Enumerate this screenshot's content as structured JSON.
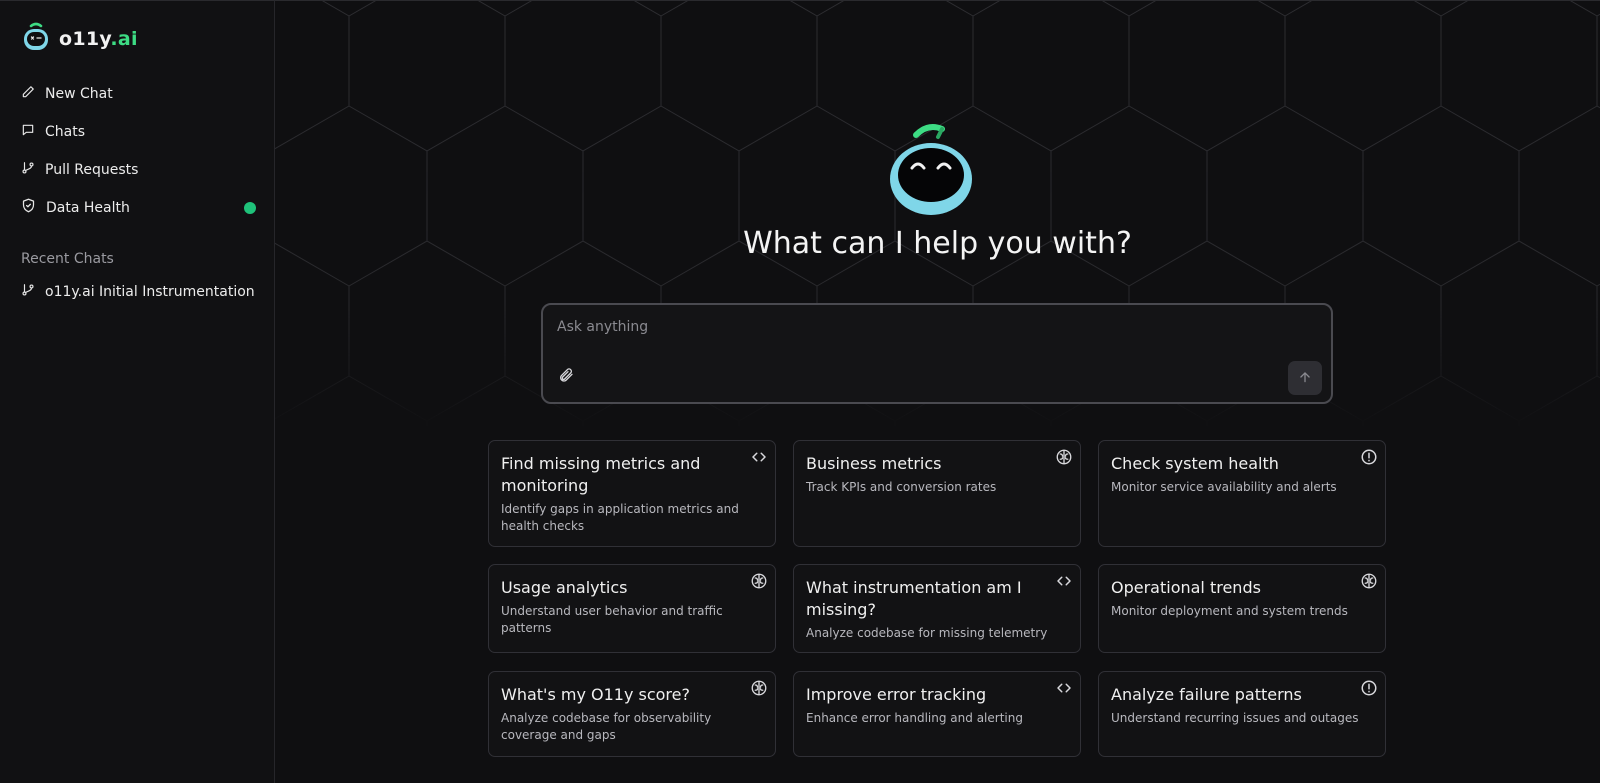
{
  "app": {
    "logo_text": "o11y",
    "logo_accent": ".ai",
    "accent_color": "#3ddc84"
  },
  "sidebar": {
    "nav": [
      {
        "label": "New Chat",
        "icon": "pencil-icon"
      },
      {
        "label": "Chats",
        "icon": "chat-bubble-icon"
      },
      {
        "label": "Pull Requests",
        "icon": "git-branch-icon"
      },
      {
        "label": "Data Health",
        "icon": "shield-icon",
        "status_color": "#1fc27a"
      }
    ],
    "recent_label": "Recent Chats",
    "recent": [
      {
        "label": "o11y.ai Initial Instrumentation",
        "icon": "git-branch-icon"
      }
    ]
  },
  "main": {
    "headline": "What can I help you with?",
    "composer": {
      "placeholder": "Ask anything",
      "value": ""
    },
    "cards": [
      {
        "title": "Find missing metrics and monitoring",
        "desc": "Identify gaps in application metrics and health checks",
        "icon": "code-icon"
      },
      {
        "title": "Business metrics",
        "desc": "Track KPIs and conversion rates",
        "icon": "brain-icon"
      },
      {
        "title": "Check system health",
        "desc": "Monitor service availability and alerts",
        "icon": "alert-circle-icon"
      },
      {
        "title": "Usage analytics",
        "desc": "Understand user behavior and traffic patterns",
        "icon": "brain-icon"
      },
      {
        "title": "What instrumentation am I missing?",
        "desc": "Analyze codebase for missing telemetry",
        "icon": "code-icon"
      },
      {
        "title": "Operational trends",
        "desc": "Monitor deployment and system trends",
        "icon": "brain-icon"
      },
      {
        "title": "What's my O11y score?",
        "desc": "Analyze codebase for observability coverage and gaps",
        "icon": "brain-icon"
      },
      {
        "title": "Improve error tracking",
        "desc": "Enhance error handling and alerting",
        "icon": "code-icon"
      },
      {
        "title": "Analyze failure patterns",
        "desc": "Understand recurring issues and outages",
        "icon": "alert-circle-icon"
      }
    ]
  }
}
